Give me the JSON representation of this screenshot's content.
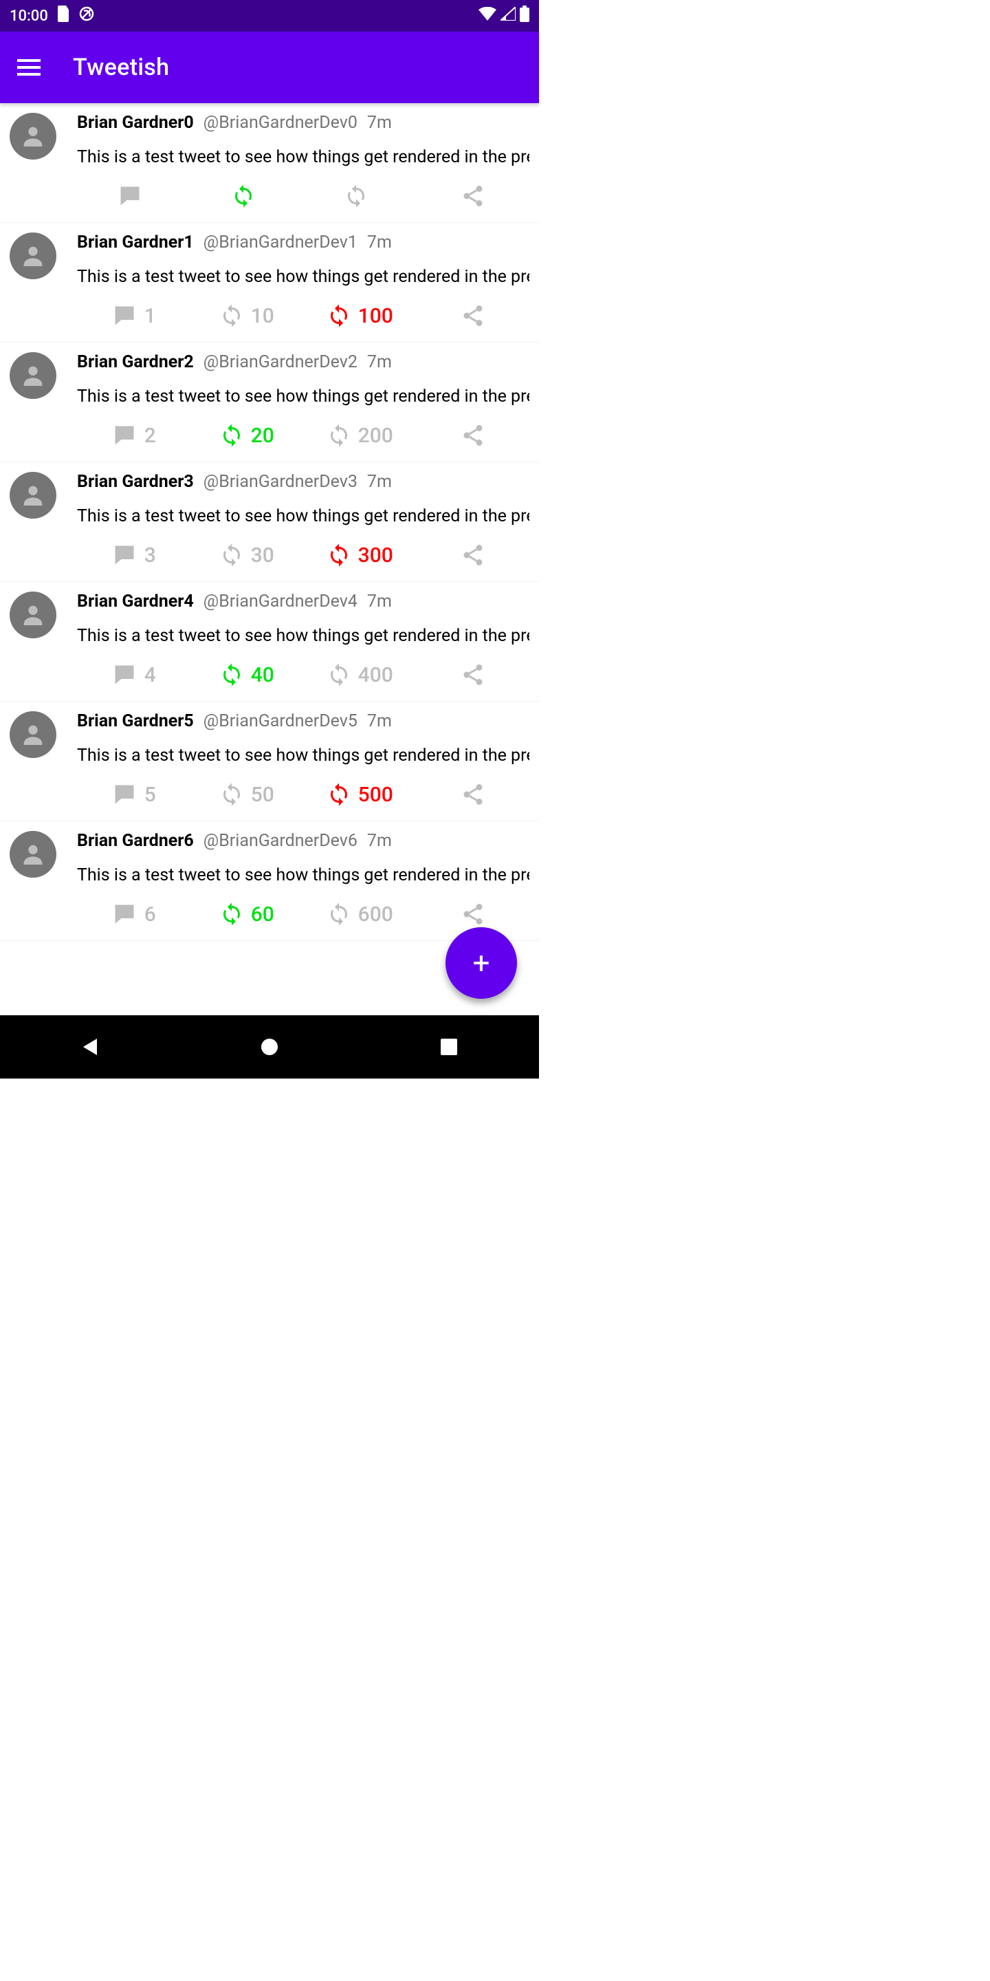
{
  "status": {
    "time": "10:00"
  },
  "appbar": {
    "title": "Tweetish"
  },
  "colors": {
    "statusbar": "#3C018D",
    "appbar": "#6200EE",
    "muted": "#BDBDBD",
    "textMuted": "#757575",
    "green": "#00E013",
    "red": "#FF0000",
    "avatarBg": "#757575"
  },
  "fab": {
    "label": "+"
  },
  "tweets": [
    {
      "name": "Brian Gardner0",
      "handle": "@BrianGardnerDev0",
      "time": "7m",
      "content": "This is a test tweet to see how things get rendered in the preview",
      "comments": "",
      "retweets": "",
      "likes": "",
      "retweetActive": true,
      "likeActive": false
    },
    {
      "name": "Brian Gardner1",
      "handle": "@BrianGardnerDev1",
      "time": "7m",
      "content": "This is a test tweet to see how things get rendered in the preview",
      "comments": "1",
      "retweets": "10",
      "likes": "100",
      "retweetActive": false,
      "likeActive": true
    },
    {
      "name": "Brian Gardner2",
      "handle": "@BrianGardnerDev2",
      "time": "7m",
      "content": "This is a test tweet to see how things get rendered in the preview",
      "comments": "2",
      "retweets": "20",
      "likes": "200",
      "retweetActive": true,
      "likeActive": false
    },
    {
      "name": "Brian Gardner3",
      "handle": "@BrianGardnerDev3",
      "time": "7m",
      "content": "This is a test tweet to see how things get rendered in the preview",
      "comments": "3",
      "retweets": "30",
      "likes": "300",
      "retweetActive": false,
      "likeActive": true
    },
    {
      "name": "Brian Gardner4",
      "handle": "@BrianGardnerDev4",
      "time": "7m",
      "content": "This is a test tweet to see how things get rendered in the preview",
      "comments": "4",
      "retweets": "40",
      "likes": "400",
      "retweetActive": true,
      "likeActive": false
    },
    {
      "name": "Brian Gardner5",
      "handle": "@BrianGardnerDev5",
      "time": "7m",
      "content": "This is a test tweet to see how things get rendered in the preview",
      "comments": "5",
      "retweets": "50",
      "likes": "500",
      "retweetActive": false,
      "likeActive": true
    },
    {
      "name": "Brian Gardner6",
      "handle": "@BrianGardnerDev6",
      "time": "7m",
      "content": "This is a test tweet to see how things get rendered in the preview",
      "comments": "6",
      "retweets": "60",
      "likes": "600",
      "retweetActive": true,
      "likeActive": false
    }
  ]
}
